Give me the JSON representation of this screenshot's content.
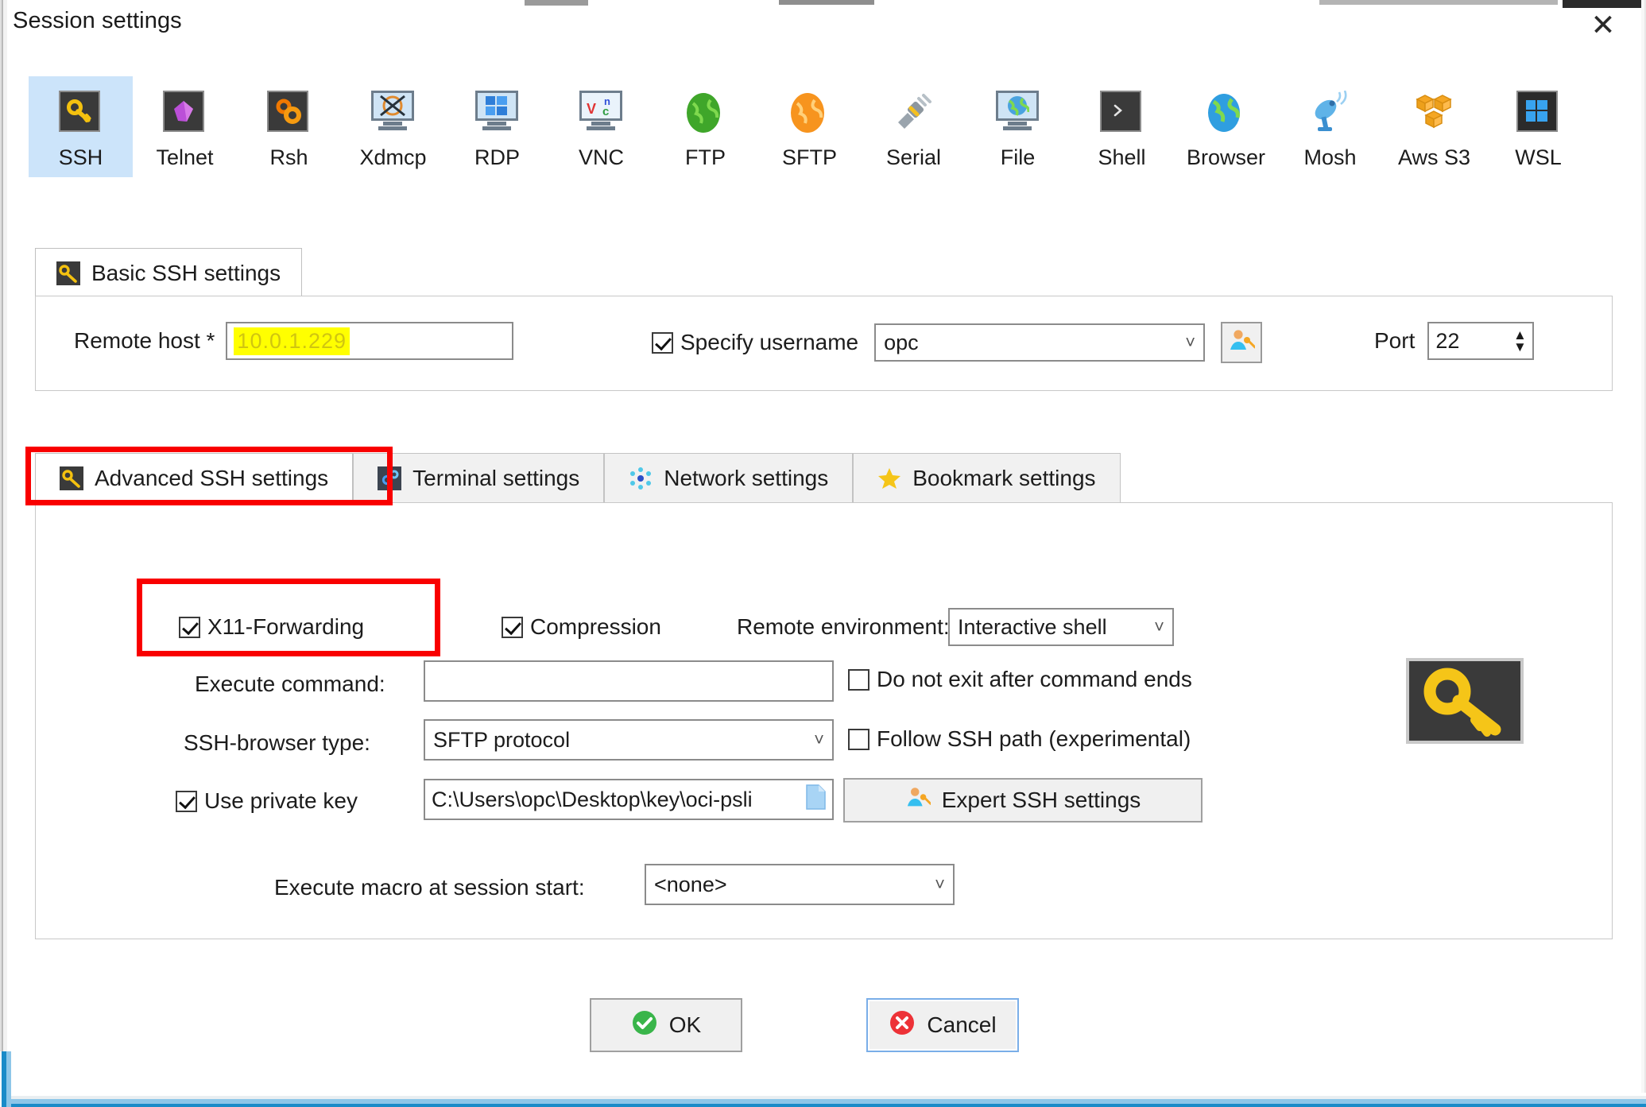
{
  "window": {
    "title": "Session settings",
    "close_icon": "close-icon"
  },
  "session_types": [
    {
      "label": "SSH",
      "icon": "ssh-key-icon",
      "selected": true
    },
    {
      "label": "Telnet",
      "icon": "telnet-gem-icon",
      "selected": false
    },
    {
      "label": "Rsh",
      "icon": "rsh-gears-icon",
      "selected": false
    },
    {
      "label": "Xdmcp",
      "icon": "xdmcp-monitor-icon",
      "selected": false
    },
    {
      "label": "RDP",
      "icon": "rdp-windows-icon",
      "selected": false
    },
    {
      "label": "VNC",
      "icon": "vnc-monitor-icon",
      "selected": false
    },
    {
      "label": "FTP",
      "icon": "ftp-globe-icon",
      "selected": false
    },
    {
      "label": "SFTP",
      "icon": "sftp-globe-icon",
      "selected": false
    },
    {
      "label": "Serial",
      "icon": "serial-plug-icon",
      "selected": false
    },
    {
      "label": "File",
      "icon": "file-monitor-icon",
      "selected": false
    },
    {
      "label": "Shell",
      "icon": "shell-prompt-icon",
      "selected": false
    },
    {
      "label": "Browser",
      "icon": "browser-globe-icon",
      "selected": false
    },
    {
      "label": "Mosh",
      "icon": "mosh-dish-icon",
      "selected": false
    },
    {
      "label": "Aws S3",
      "icon": "aws-s3-cubes-icon",
      "selected": false
    },
    {
      "label": "WSL",
      "icon": "wsl-windows-icon",
      "selected": false
    }
  ],
  "basic": {
    "tab_label": "Basic SSH settings",
    "tab_icon": "wrench-icon",
    "remote_host_label": "Remote host *",
    "remote_host_value": "10.0.1.229",
    "remote_host_redacted": true,
    "specify_username_label": "Specify username",
    "specify_username_checked": true,
    "username_value": "opc",
    "user_key_button_icon": "user-key-icon",
    "port_label": "Port",
    "port_value": "22"
  },
  "inner_tabs": [
    {
      "label": "Advanced SSH settings",
      "icon": "wrench-icon",
      "active": true,
      "highlighted": true
    },
    {
      "label": "Terminal settings",
      "icon": "gear-blue-icon",
      "active": false,
      "highlighted": false
    },
    {
      "label": "Network settings",
      "icon": "network-icon",
      "active": false,
      "highlighted": false
    },
    {
      "label": "Bookmark settings",
      "icon": "star-icon",
      "active": false,
      "highlighted": false
    }
  ],
  "advanced": {
    "x11_label": "X11-Forwarding",
    "x11_checked": true,
    "x11_highlighted": true,
    "compression_label": "Compression",
    "compression_checked": true,
    "remote_env_label": "Remote environment:",
    "remote_env_value": "Interactive shell",
    "execute_command_label": "Execute command:",
    "execute_command_value": "",
    "do_not_exit_label": "Do not exit after command ends",
    "do_not_exit_checked": false,
    "ssh_browser_label": "SSH-browser type:",
    "ssh_browser_value": "SFTP protocol",
    "follow_ssh_path_label": "Follow SSH path (experimental)",
    "follow_ssh_path_checked": false,
    "use_private_key_label": "Use private key",
    "use_private_key_checked": true,
    "private_key_value": "C:\\Users\\opc\\Desktop\\key\\oci-psli",
    "private_key_browse_icon": "file-browse-icon",
    "expert_button_label": "Expert SSH settings",
    "expert_button_icon": "user-key-icon",
    "macro_label": "Execute macro at session start:",
    "macro_value": "<none>",
    "key_badge_icon": "key-icon"
  },
  "footer": {
    "ok_label": "OK",
    "ok_icon": "check-circle-icon",
    "cancel_label": "Cancel",
    "cancel_icon": "x-circle-icon"
  },
  "colors": {
    "selection_blue": "#cce4fa",
    "highlight_red": "#f90000",
    "redaction_yellow": "#ffff00",
    "ok_green": "#39b54a",
    "cancel_red": "#ed3237",
    "accent_blue": "#1a8bc8"
  }
}
